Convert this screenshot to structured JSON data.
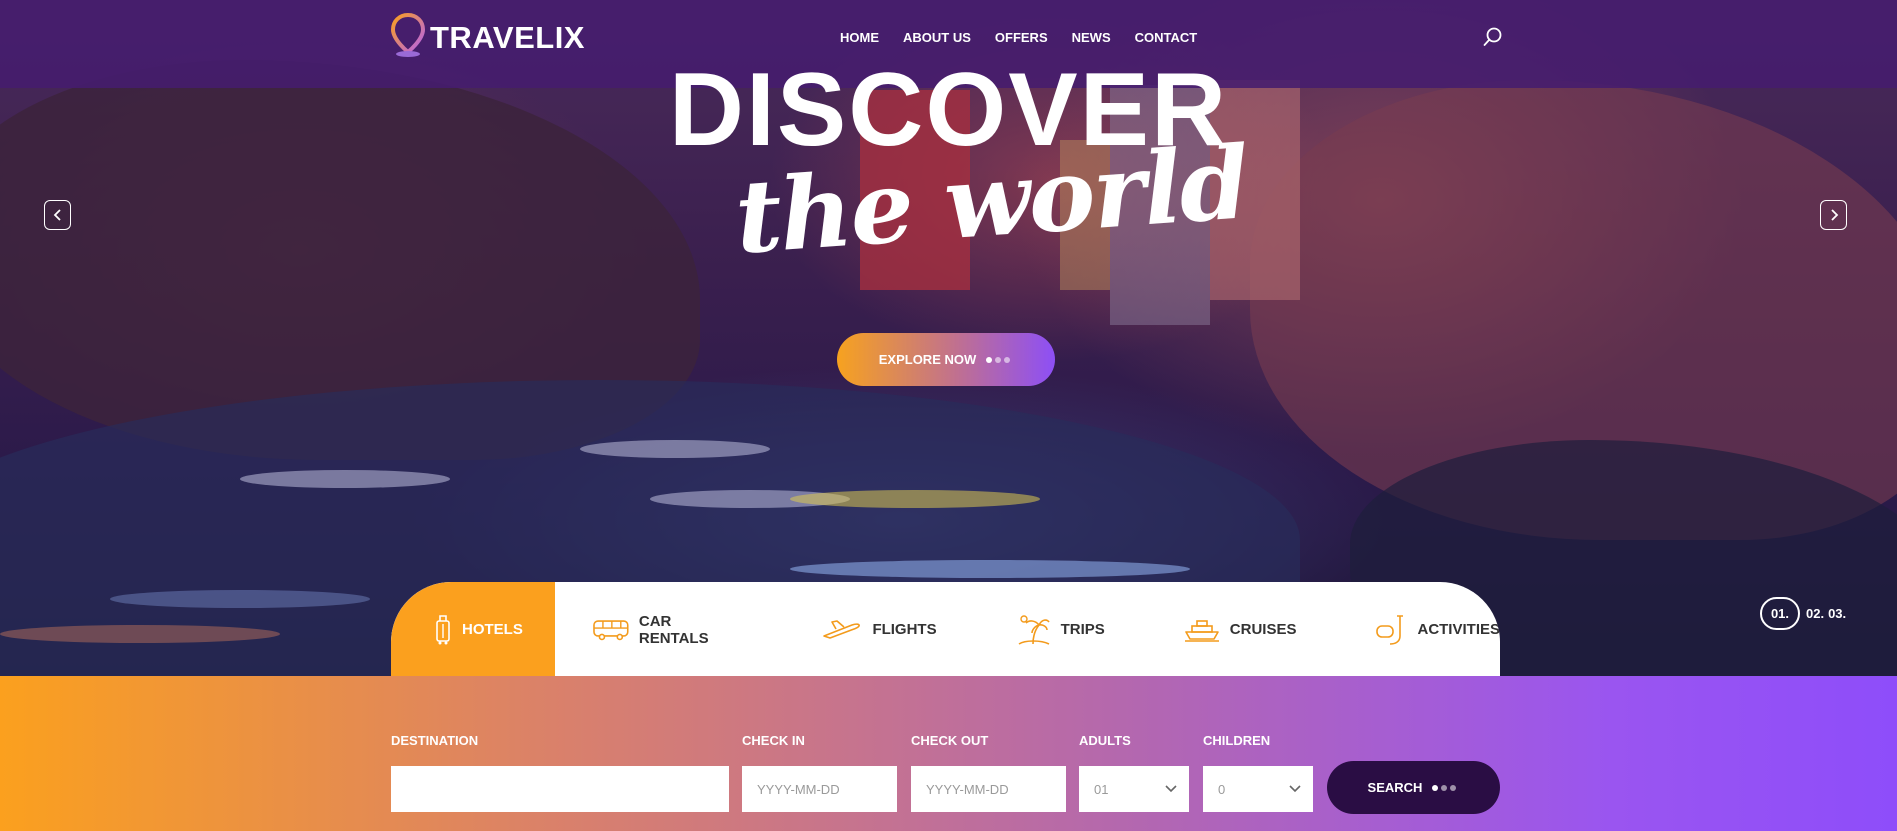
{
  "header": {
    "logo_text": "TRAVELIX",
    "nav": [
      "HOME",
      "ABOUT US",
      "OFFERS",
      "NEWS",
      "CONTACT"
    ],
    "search_icon": "search-icon"
  },
  "hero": {
    "title": "DISCOVER",
    "subtitle": "the world",
    "cta_label": "EXPLORE NOW",
    "prev_icon": "chevron-left-icon",
    "next_icon": "chevron-right-icon",
    "slides": [
      "01.",
      "02.",
      "03."
    ]
  },
  "tabs": [
    {
      "label": "HOTELS",
      "icon": "suitcase-icon",
      "active": true
    },
    {
      "label": "CAR RENTALS",
      "icon": "bus-icon",
      "active": false
    },
    {
      "label": "FLIGHTS",
      "icon": "plane-icon",
      "active": false
    },
    {
      "label": "TRIPS",
      "icon": "island-icon",
      "active": false
    },
    {
      "label": "CRUISES",
      "icon": "ship-icon",
      "active": false
    },
    {
      "label": "ACTIVITIES",
      "icon": "snorkel-icon",
      "active": false
    }
  ],
  "search": {
    "destination_label": "DESTINATION",
    "destination_value": "",
    "checkin_label": "CHECK IN",
    "checkin_placeholder": "YYYY-MM-DD",
    "checkout_label": "CHECK OUT",
    "checkout_placeholder": "YYYY-MM-DD",
    "adults_label": "ADULTS",
    "adults_value": "01",
    "children_label": "CHILDREN",
    "children_value": "0",
    "button_label": "SEARCH"
  },
  "colors": {
    "accent_orange": "#fba01e",
    "accent_purple": "#8e4dfa",
    "header_bg": "#461c6e",
    "search_button": "#2a0d44"
  }
}
